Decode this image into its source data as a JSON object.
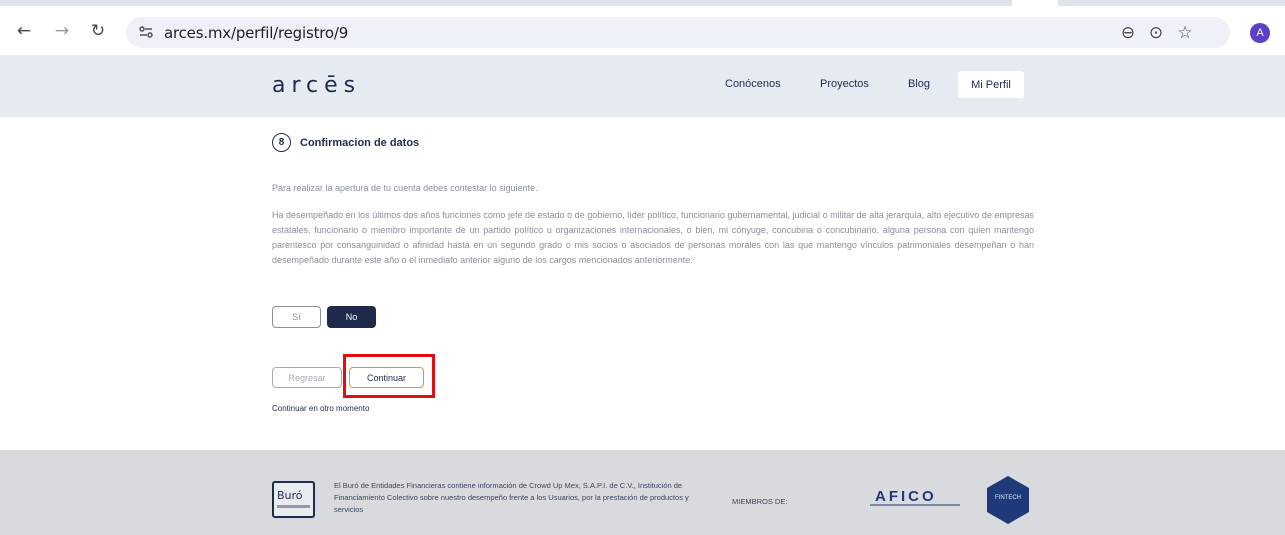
{
  "browser": {
    "back_glyph": "←",
    "forward_glyph": "→",
    "reload_glyph": "↻",
    "url": "arces.mx/perfil/registro/9",
    "zoom_glyph": "⊖",
    "location_glyph": "⊙",
    "star_glyph": "☆",
    "avatar_letter": "A",
    "avatar_color": "#5b3fc4"
  },
  "site": {
    "logo": "arcēs",
    "nav": [
      {
        "label": "Conócenos"
      },
      {
        "label": "Proyectos"
      },
      {
        "label": "Blog"
      },
      {
        "label": "Mi Perfil",
        "active": true
      }
    ]
  },
  "form": {
    "step_number": "8",
    "step_title": "Confirmacion de datos",
    "intro": "Para realizar la apertura de tu cuenta debes contestar lo siguiente.",
    "question": "Ha desempeñado en los últimos dos años funciones como jefe de estado o de gobierno, líder político, funcionario gubernamental, judicial o militar de alta jerarquía, alto ejecutivo de empresas estatales, funcionario o miembro importante de un partido político u organizaciones internacionales, o bien, mi cónyuge, concubina o concubinario, alguna persona con quien mantengo parentesco por consanguinidad o afinidad hasta en un segundo grado o mis socios o asociados de personas morales con las que mantengo vínculos patrimoniales desempeñan o han desempeñado durante este año o el inmediato anterior alguno de los cargos mencionados anteriormente.",
    "options": {
      "yes": "Sí",
      "no": "No",
      "selected": "No"
    },
    "back_label": "Regresar",
    "continue_label": "Continuar",
    "later_link": "Continuar en otro momento"
  },
  "footer": {
    "buro_label": "Buró",
    "legal": "El Buró de Entidades Financieras contiene información de Crowd Up Mex, S.A.P.I. de C.V., Institución de Financiamiento Colectivo sobre nuestro desempeño frente a los Usuarios, por la prestación de productos y servicios",
    "members_label": "MIEMBROS DE:",
    "afico_label": "AFICO",
    "fintech_label": "FINTECH"
  },
  "colors": {
    "navy": "#1f2b4d",
    "highlight_red": "#e10e0e",
    "continue_border": "#e8951c",
    "header_bg": "#e6ebf1",
    "footer_bg": "#d8dade"
  }
}
